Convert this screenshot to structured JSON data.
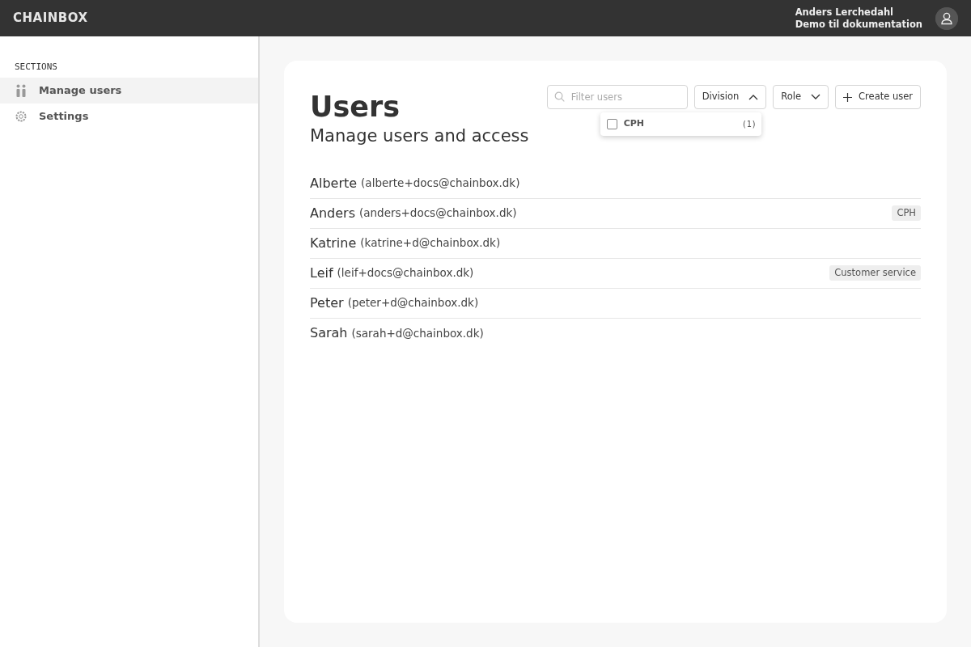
{
  "topbar": {
    "logo": "CHAINBOX",
    "user_name": "Anders Lerchedahl",
    "organization": "Demo til dokumentation"
  },
  "sidebar": {
    "heading": "SECTIONS",
    "items": [
      {
        "label": "Manage users",
        "kind": "users",
        "selected": true
      },
      {
        "label": "Settings",
        "kind": "settings",
        "selected": false
      }
    ]
  },
  "page": {
    "title": "Users",
    "subtitle": "Manage users and access"
  },
  "toolbar": {
    "search": {
      "placeholder": "Filter users"
    },
    "filters": [
      {
        "label": "Division",
        "expanded": true,
        "options": [
          {
            "label": "CPH",
            "count": "(1)",
            "checked": false
          }
        ]
      },
      {
        "label": "Role",
        "expanded": false
      }
    ],
    "create_button": "Create user"
  },
  "users": [
    {
      "name": "Alberte",
      "email": "(alberte+docs@chainbox.dk)"
    },
    {
      "name": "Anders",
      "email": "(anders+docs@chainbox.dk)",
      "tag": "CPH"
    },
    {
      "name": "Katrine",
      "email": "(katrine+d@chainbox.dk)"
    },
    {
      "name": "Leif",
      "email": "(leif+docs@chainbox.dk)",
      "tag": "Customer service"
    },
    {
      "name": "Peter",
      "email": "(peter+d@chainbox.dk)"
    },
    {
      "name": "Sarah",
      "email": "(sarah+d@chainbox.dk)"
    }
  ]
}
